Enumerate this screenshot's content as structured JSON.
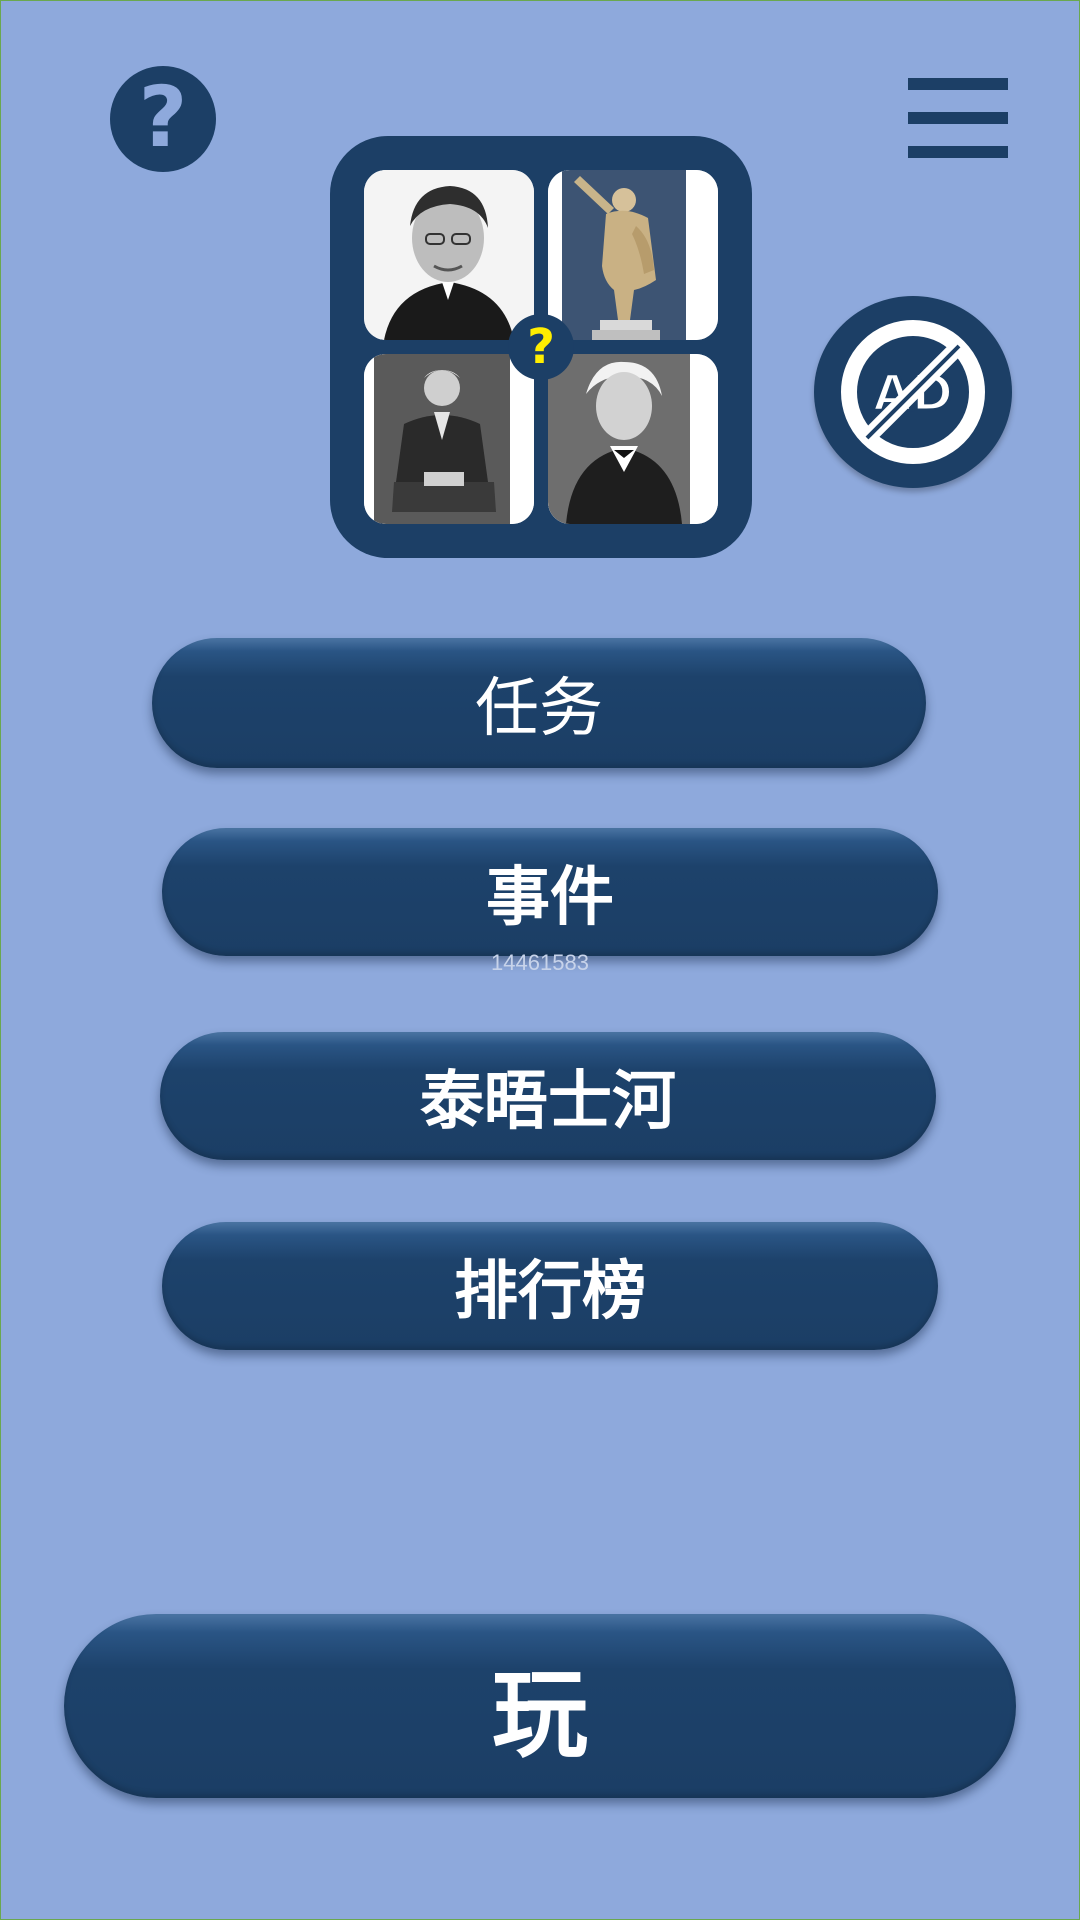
{
  "header": {
    "help_icon_glyph": "?",
    "help_icon": "question-mark-icon",
    "menu_icon": "hamburger-menu-icon",
    "no_ads_icon": "no-ads-icon",
    "no_ads_text": "AD"
  },
  "logo": {
    "badge_glyph": "?",
    "tiles": [
      "portrait-bearded-man",
      "roman-statue",
      "seated-old-man",
      "white-haired-man"
    ]
  },
  "menu": {
    "tasks_label": "任务",
    "events_label": "事件",
    "thames_label": "泰晤士河",
    "leaderboard_label": "排行榜"
  },
  "overlay_code": "14461583",
  "play": {
    "label": "玩"
  },
  "colors": {
    "background": "#8ea9dc",
    "button": "#1c3f66",
    "badge_question": "#ffee00",
    "text": "#ffffff"
  }
}
